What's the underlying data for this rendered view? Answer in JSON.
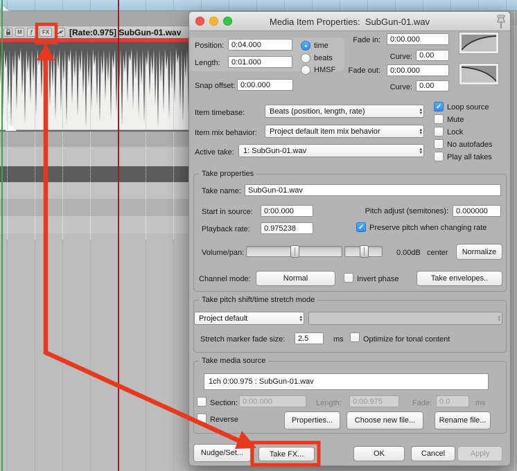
{
  "colors": {
    "annotation_red": "#e6391e",
    "item_stripe_red": "#d2433c",
    "checkbox_blue": "#3b9bf3",
    "ruler_blue": "#aecde2",
    "playhead_red": "#9b1c24",
    "edit_cursor_green": "#2fa84f"
  },
  "arrange": {
    "item_label": "[Rate:0.975] SubGun-01.wav",
    "mute_button": "M",
    "notes_button": "ƒ",
    "fx_button": "FX"
  },
  "dialog": {
    "title": "Media Item Properties:  SubGun-01.wav",
    "position_label": "Position:",
    "position_value": "0:04.000",
    "length_label": "Length:",
    "length_value": "0:01.000",
    "unit_time": "time",
    "unit_beats": "beats",
    "unit_hmsf": "HMSF",
    "fade_in_label": "Fade in:",
    "fade_in_value": "0:00.000",
    "curve_in_label": "Curve:",
    "curve_in_value": "0.00",
    "fade_out_label": "Fade out:",
    "fade_out_value": "0:00.000",
    "curve_out_label": "Curve:",
    "curve_out_value": "0.00",
    "snap_offset_label": "Snap offset:",
    "snap_offset_value": "0:00.000",
    "timebase_label": "Item timebase:",
    "timebase_value": "Beats (position, length, rate)",
    "mix_label": "Item mix behavior:",
    "mix_value": "Project default item mix behavior",
    "active_take_label": "Active take:",
    "active_take_value": "1: SubGun-01.wav",
    "loop_source": "Loop source",
    "mute": "Mute",
    "lock": "Lock",
    "no_autofades": "No autofades",
    "play_all_takes": "Play all takes",
    "take_properties_title": "Take properties",
    "take_name_label": "Take name:",
    "take_name_value": "SubGun-01.wav",
    "start_in_source_label": "Start in source:",
    "start_in_source_value": "0:00.000",
    "pitch_adjust_label": "Pitch adjust (semitones):",
    "pitch_adjust_value": "0.000000",
    "playback_rate_label": "Playback rate:",
    "playback_rate_value": "0.975238",
    "preserve_pitch": "Preserve pitch when changing rate",
    "volume_pan_label": "Volume/pan:",
    "volume_db": "0.00dB",
    "pan_center": "center",
    "normalize_btn": "Normalize",
    "channel_mode_label": "Channel mode:",
    "channel_mode_value": "Normal",
    "invert_phase": "Invert phase",
    "take_envelopes_btn": "Take envelopes..",
    "pitch_mode_title": "Take pitch shift/time stretch mode",
    "pitch_mode_value": "Project default",
    "stretch_label": "Stretch marker fade size:",
    "stretch_value": "2.5",
    "stretch_ms": "ms",
    "optimize": "Optimize for tonal content",
    "source_title": "Take media source",
    "source_info": "1ch 0:00.975 : SubGun-01.wav",
    "section_label": "Section:",
    "section_value": "0:00.000",
    "section_length_label": "Length:",
    "section_length_value": "0:00.975",
    "section_fade_label": "Fade:",
    "section_fade_value": "0.0",
    "section_ms": "ms",
    "reverse": "Reverse",
    "properties_btn": "Properties...",
    "choose_btn": "Choose new file...",
    "rename_btn": "Rename file...",
    "nudge_btn": "Nudge/Set...",
    "take_fx_btn": "Take FX...",
    "ok_btn": "OK",
    "cancel_btn": "Cancel",
    "apply_btn": "Apply"
  }
}
